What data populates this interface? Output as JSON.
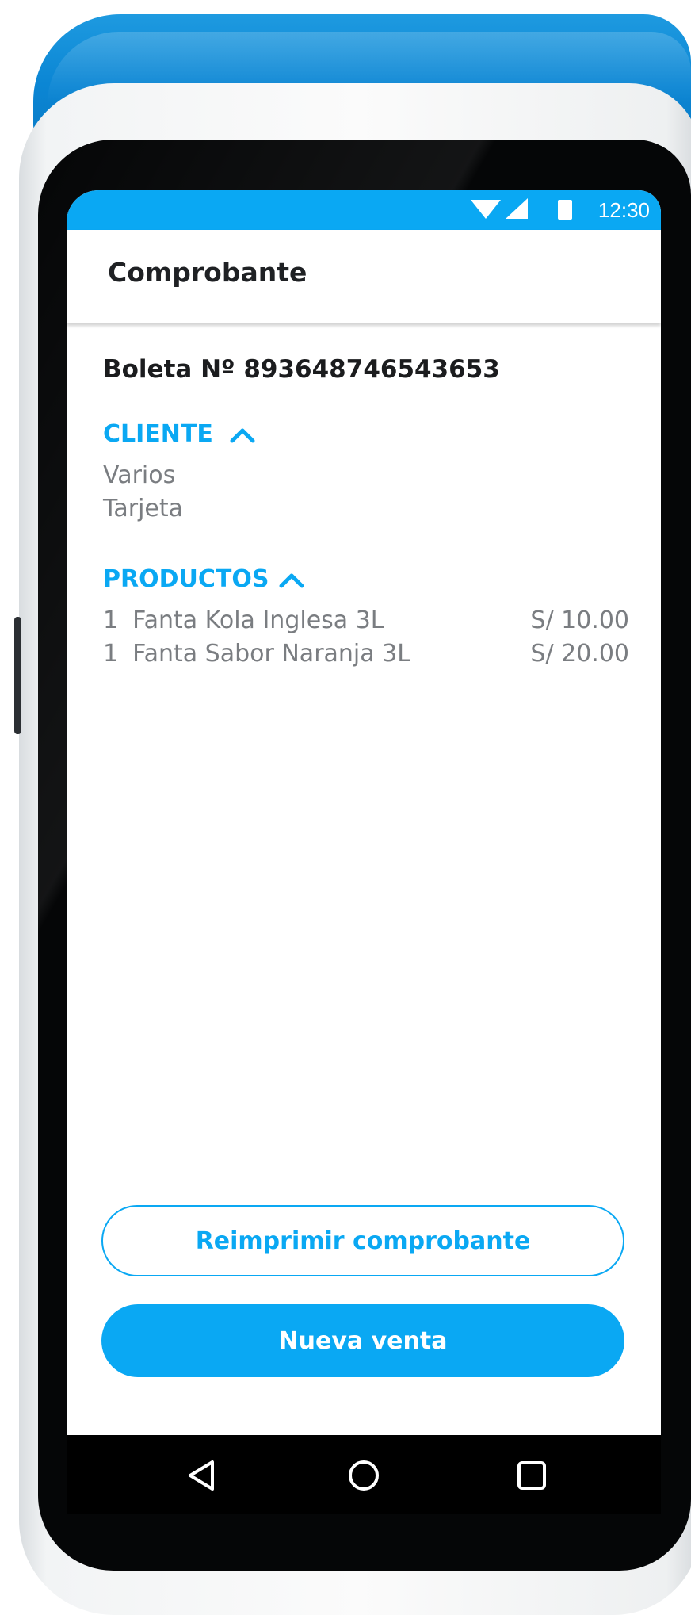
{
  "status_bar": {
    "time": "12:30"
  },
  "app_bar": {
    "title": "Comprobante"
  },
  "receipt": {
    "number_label": "Boleta Nº 893648746543653"
  },
  "cliente": {
    "header": "CLIENTE",
    "lines": [
      "Varios",
      "Tarjeta"
    ]
  },
  "productos": {
    "header": "PRODUCTOS",
    "items": [
      {
        "qty": "1",
        "name": "Fanta Kola Inglesa 3L",
        "price": "S/ 10.00"
      },
      {
        "qty": "1",
        "name": "Fanta Sabor Naranja 3L",
        "price": "S/ 20.00"
      }
    ]
  },
  "actions": {
    "reprint_label": "Reimprimir comprobante",
    "new_sale_label": "Nueva venta"
  },
  "colors": {
    "accent": "#0aa8f3",
    "device_blue": "#0b86d4",
    "text_dark": "#1b1c1e",
    "text_muted": "#7a7d81"
  },
  "icons": {
    "wifi": "wifi-icon",
    "signal": "signal-icon",
    "battery": "battery-icon",
    "chevron": "chevron-up-icon",
    "back": "back-triangle-icon",
    "home": "home-circle-icon",
    "recents": "recents-square-icon"
  }
}
